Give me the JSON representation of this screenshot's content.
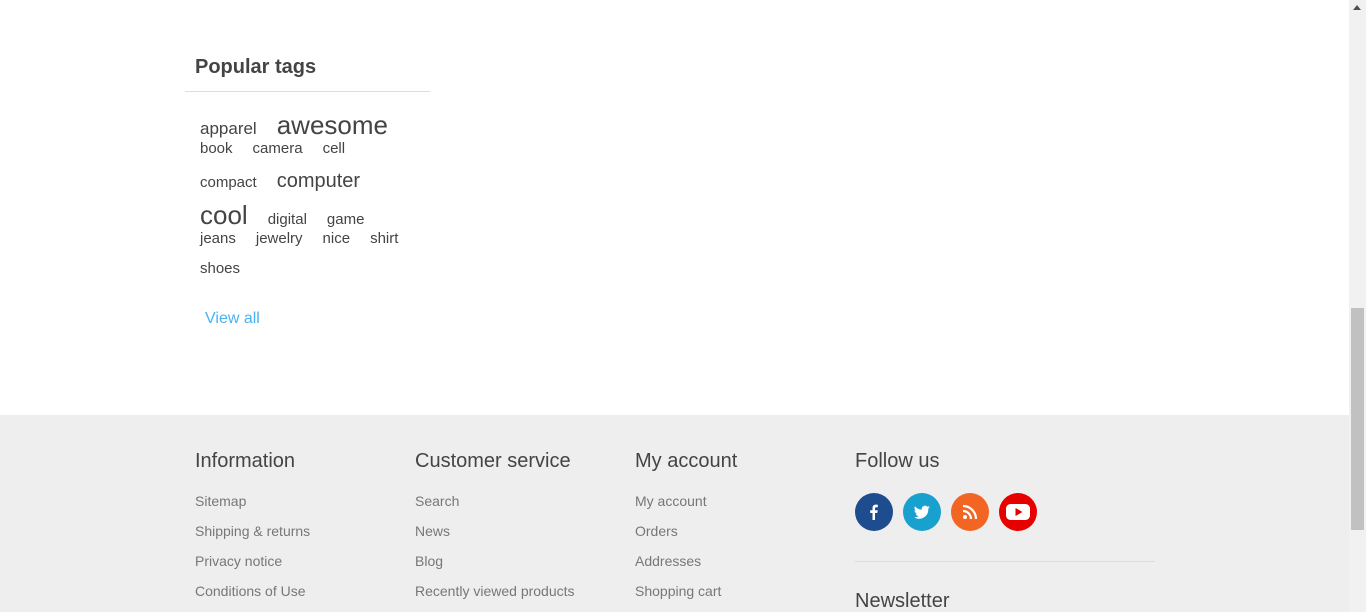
{
  "popular_tags": {
    "title": "Popular tags",
    "rows": [
      [
        {
          "label": "apparel",
          "size": "s17"
        },
        {
          "label": "awesome",
          "size": "s26"
        }
      ],
      [
        {
          "label": "book",
          "size": "s15"
        },
        {
          "label": "camera",
          "size": "s15"
        },
        {
          "label": "cell",
          "size": "s15"
        }
      ],
      [
        {
          "label": "compact",
          "size": "s15"
        },
        {
          "label": "computer",
          "size": "s20"
        }
      ],
      [
        {
          "label": "cool",
          "size": "s26"
        },
        {
          "label": "digital",
          "size": "s15"
        },
        {
          "label": "game",
          "size": "s15"
        }
      ],
      [
        {
          "label": "jeans",
          "size": "s15"
        },
        {
          "label": "jewelry",
          "size": "s15"
        },
        {
          "label": "nice",
          "size": "s15"
        },
        {
          "label": "shirt",
          "size": "s15"
        }
      ],
      [
        {
          "label": "shoes",
          "size": "s15"
        }
      ]
    ],
    "view_all": "View all"
  },
  "footer": {
    "information": {
      "title": "Information",
      "links": [
        "Sitemap",
        "Shipping & returns",
        "Privacy notice",
        "Conditions of Use"
      ]
    },
    "customer_service": {
      "title": "Customer service",
      "links": [
        "Search",
        "News",
        "Blog",
        "Recently viewed products"
      ]
    },
    "my_account": {
      "title": "My account",
      "links": [
        "My account",
        "Orders",
        "Addresses",
        "Shopping cart"
      ]
    },
    "follow_us": {
      "title": "Follow us",
      "networks": [
        {
          "icon": "facebook-icon",
          "color": "#1d4d8e"
        },
        {
          "icon": "twitter-icon",
          "color": "#18a0cf"
        },
        {
          "icon": "rss-icon",
          "color": "#f26522"
        },
        {
          "icon": "youtube-icon",
          "color": "#e60000"
        }
      ]
    },
    "newsletter": {
      "title": "Newsletter"
    }
  },
  "colors": {
    "footer_bg": "#eeeeee",
    "link_accent": "#4ab2f1"
  }
}
